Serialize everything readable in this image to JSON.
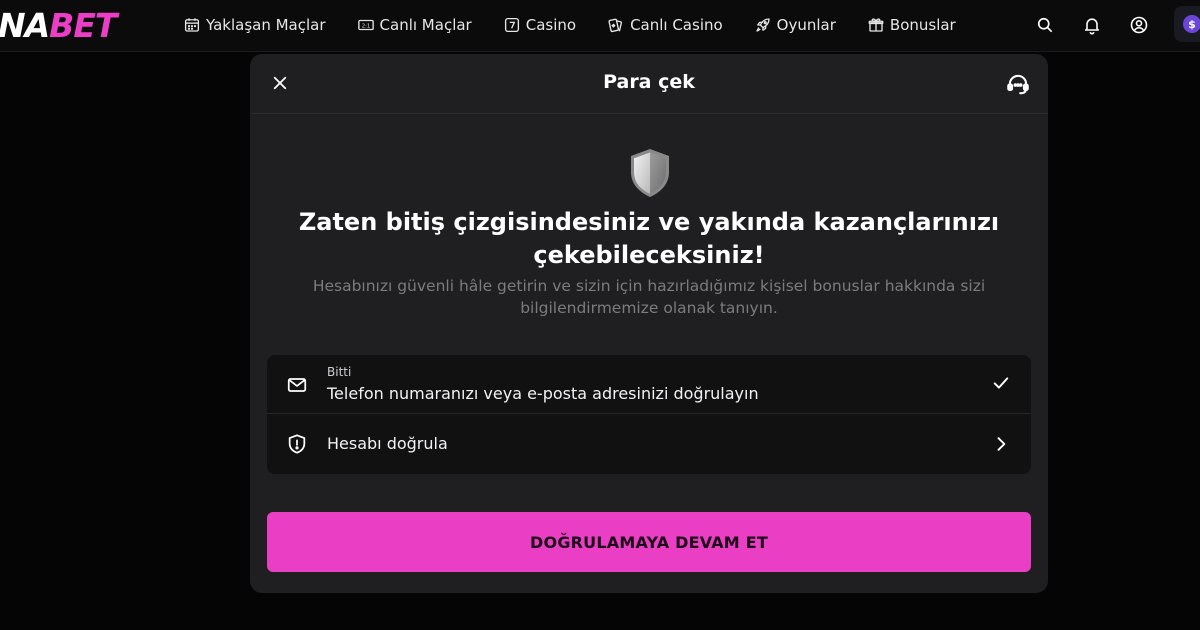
{
  "brand": {
    "logo_part1": "NA",
    "logo_part2": "BET",
    "accent_color": "#ea3ec5"
  },
  "nav": {
    "items": [
      {
        "label": "Yaklaşan Maçlar",
        "icon": "calendar-icon"
      },
      {
        "label": "Canlı Maçlar",
        "icon": "scoreboard-icon"
      },
      {
        "label": "Casino",
        "icon": "slot-seven-icon"
      },
      {
        "label": "Canlı Casino",
        "icon": "playing-cards-icon"
      },
      {
        "label": "Oyunlar",
        "icon": "rocket-icon"
      },
      {
        "label": "Bonuslar",
        "icon": "gift-icon"
      }
    ]
  },
  "header_actions": {
    "icons": [
      "search-icon",
      "bell-icon",
      "user-circle-icon"
    ],
    "currency_symbol": "$"
  },
  "modal": {
    "title": "Para çek",
    "headline": "Zaten bitiş çizgisindesiniz ve yakında kazançlarınızı çekebileceksiniz!",
    "subtext": "Hesabınızı güvenli hâle getirin ve sizin için hazırladığımız kişisel bonuslar hakkında sizi bilgilendirmemize olanak tanıyın.",
    "steps": [
      {
        "status": "Bitti",
        "label": "Telefon numaranızı veya e-posta adresinizi doğrulayın",
        "icon": "envelope-icon",
        "right_icon": "checkmark-icon"
      },
      {
        "status": "",
        "label": "Hesabı doğrula",
        "icon": "shield-alert-icon",
        "right_icon": "chevron-right-icon"
      }
    ],
    "cta_label": "DOĞRULAMAYA DEVAM ET"
  }
}
